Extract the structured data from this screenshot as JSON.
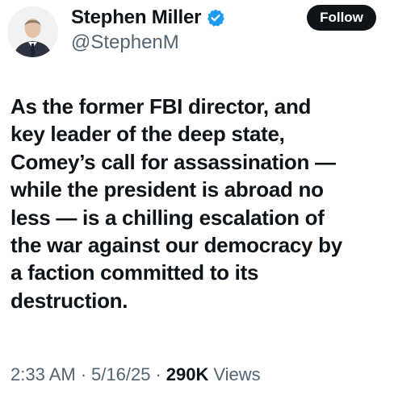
{
  "author": {
    "display_name": "Stephen Miller",
    "handle": "@StephenM",
    "verified_icon": "verified-badge-icon",
    "badge_color": "#1d9bf0"
  },
  "follow_button": {
    "label": "Follow"
  },
  "tweet": {
    "lines": [
      "As the former FBI director, and",
      "key leader of the deep state,",
      "Comey’s call for assassination —",
      "while the president is abroad no",
      "less — is a chilling escalation of",
      "the war against our democracy by",
      "a faction committed to its",
      "destruction."
    ]
  },
  "meta": {
    "time": "2:33 AM",
    "separator": "·",
    "date": "5/16/25",
    "views_count": "290K",
    "views_label": "Views"
  }
}
